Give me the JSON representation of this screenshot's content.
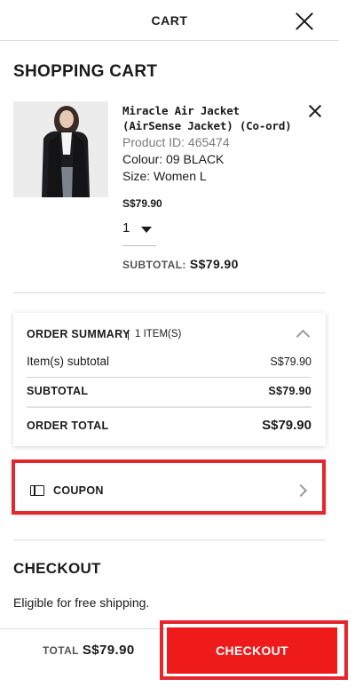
{
  "header": {
    "title": "CART",
    "close_icon": "close-icon"
  },
  "cart": {
    "heading": "SHOPPING CART",
    "item": {
      "name": "Miracle Air Jacket (AirSense Jacket) (Co-ord)",
      "product_id": "Product ID: 465474",
      "colour": "Colour: 09 BLACK",
      "size": "Size: Women L",
      "price": "S$79.90",
      "quantity": "1",
      "subtotal_label": "SUBTOTAL:",
      "subtotal_value": "S$79.90"
    }
  },
  "order_summary": {
    "title": "ORDER SUMMARY",
    "item_count": "1 ITEM(S)",
    "items_subtotal_label": "Item(s) subtotal",
    "items_subtotal_value": "S$79.90",
    "subtotal_label": "SUBTOTAL",
    "subtotal_value": "S$79.90",
    "order_total_label": "ORDER TOTAL",
    "order_total_value": "S$79.90"
  },
  "coupon": {
    "label": "COUPON",
    "icon": "coupon-icon"
  },
  "checkout": {
    "heading": "CHECKOUT",
    "shipping_note": "Eligible for free shipping."
  },
  "footer": {
    "total_label": "TOTAL",
    "total_value": "S$79.90",
    "checkout_button": "CHECKOUT"
  },
  "colors": {
    "accent": "#ef1a1a",
    "highlight": "#e5262d"
  }
}
